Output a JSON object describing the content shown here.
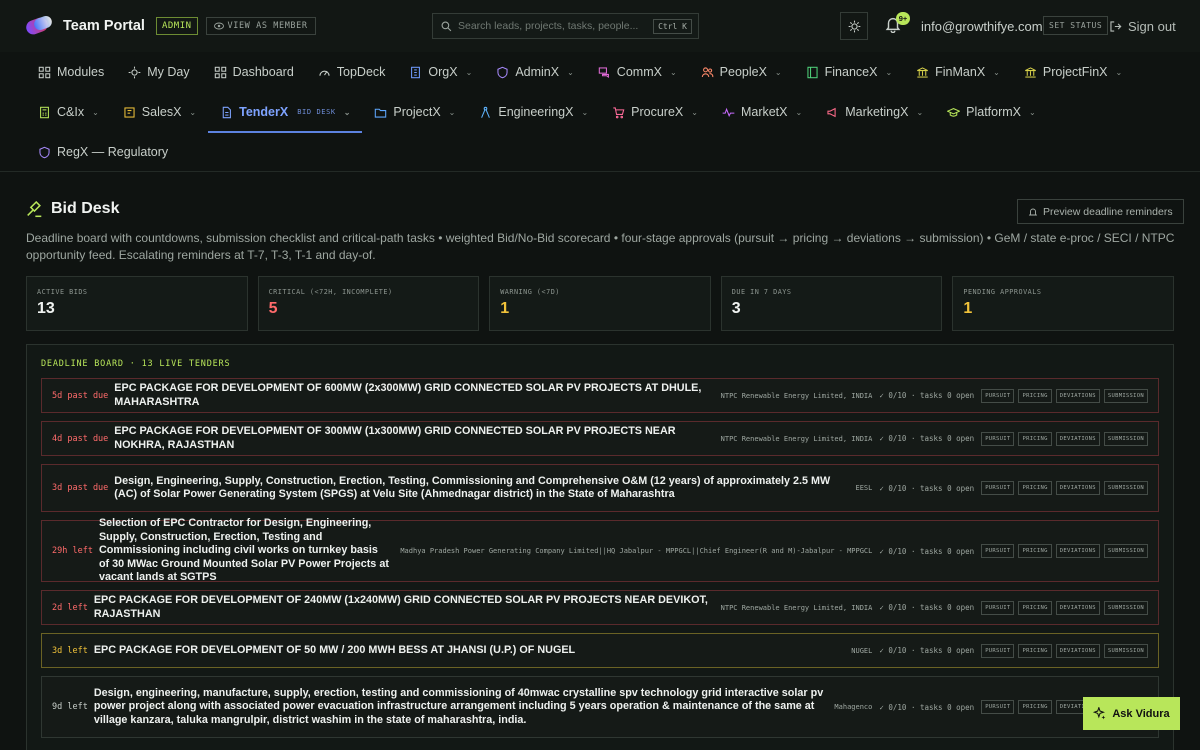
{
  "header": {
    "brand": "Team Portal",
    "admin_badge": "ADMIN",
    "view_as_member": "VIEW AS MEMBER",
    "search_placeholder": "Search leads, projects, tasks, people...",
    "search_shortcut": "Ctrl K",
    "notifications": "9+",
    "email": "info@growthifye.com",
    "set_status": "SET STATUS",
    "sign_out": "Sign out"
  },
  "nav": {
    "row1": [
      {
        "label": "Modules",
        "icon": "grid-icon",
        "chevron": false
      },
      {
        "label": "My Day",
        "icon": "sun-icon",
        "chevron": false
      },
      {
        "label": "Dashboard",
        "icon": "grid-icon",
        "chevron": false
      },
      {
        "label": "TopDeck",
        "icon": "gauge-icon",
        "chevron": false
      },
      {
        "label": "OrgX",
        "icon": "building-icon",
        "chevron": true
      },
      {
        "label": "AdminX",
        "icon": "shield-icon",
        "chevron": true
      },
      {
        "label": "CommX",
        "icon": "chat-icon",
        "chevron": true
      },
      {
        "label": "PeopleX",
        "icon": "people-icon",
        "chevron": true
      },
      {
        "label": "FinanceX",
        "icon": "ledger-icon",
        "chevron": true
      },
      {
        "label": "FinManX",
        "icon": "bank-icon",
        "chevron": true
      },
      {
        "label": "ProjectFinX",
        "icon": "bank-icon",
        "chevron": true
      }
    ],
    "row2": [
      {
        "label": "C&Ix",
        "icon": "calculator-icon",
        "chevron": true
      },
      {
        "label": "SalesX",
        "icon": "sales-icon",
        "chevron": true
      },
      {
        "label": "TenderX",
        "icon": "tender-icon",
        "chevron": true,
        "sub": "BID DESK",
        "active": true
      },
      {
        "label": "ProjectX",
        "icon": "folder-icon",
        "chevron": true
      },
      {
        "label": "EngineeringX",
        "icon": "compass-icon",
        "chevron": true
      },
      {
        "label": "ProcureX",
        "icon": "cart-icon",
        "chevron": true
      },
      {
        "label": "MarketX",
        "icon": "pulse-icon",
        "chevron": true
      },
      {
        "label": "MarketingX",
        "icon": "megaphone-icon",
        "chevron": true
      },
      {
        "label": "PlatformX",
        "icon": "cap-icon",
        "chevron": true
      }
    ],
    "row3": [
      {
        "label": "RegX — Regulatory",
        "icon": "shield-icon",
        "chevron": false
      }
    ]
  },
  "page": {
    "title": "Bid Desk",
    "preview_button": "Preview deadline reminders",
    "description": "Deadline board with countdowns, submission checklist and critical-path tasks • weighted Bid/No-Bid scorecard • four-stage approvals (pursuit → pricing → deviations → submission) • GeM / state e-proc / SECI / NTPC opportunity feed. Escalating reminders at T-7, T-3, T-1 and day-of."
  },
  "stats": [
    {
      "label": "ACTIVE BIDS",
      "value": "13",
      "color": "#f0f3f1"
    },
    {
      "label": "CRITICAL (<72H, INCOMPLETE)",
      "value": "5",
      "color": "#ff6b6b"
    },
    {
      "label": "WARNING (<7D)",
      "value": "1",
      "color": "#f0c23a"
    },
    {
      "label": "DUE IN 7 DAYS",
      "value": "3",
      "color": "#f0f3f1"
    },
    {
      "label": "PENDING APPROVALS",
      "value": "1",
      "color": "#f0c23a"
    }
  ],
  "board": {
    "title": "DEADLINE BOARD · 13 LIVE TENDERS",
    "stages": [
      "PURSUIT",
      "PRICING",
      "DEVIATIONS",
      "SUBMISSION"
    ],
    "tenders": [
      {
        "due": "5d past due",
        "level": "critical",
        "title": "EPC PACKAGE FOR DEVELOPMENT OF 600MW (2x300MW) GRID CONNECTED SOLAR PV PROJECTS AT DHULE, MAHARASHTRA",
        "org": "NTPC Renewable Energy Limited, INDIA",
        "tasks": "✓ 0/10 · tasks 0 open"
      },
      {
        "due": "4d past due",
        "level": "critical",
        "title": "EPC PACKAGE FOR DEVELOPMENT OF 300MW (1x300MW) GRID CONNECTED SOLAR PV PROJECTS NEAR NOKHRA, RAJASTHAN",
        "org": "NTPC Renewable Energy Limited, INDIA",
        "tasks": "✓ 0/10 · tasks 0 open"
      },
      {
        "due": "3d past due",
        "level": "critical",
        "title": "Design, Engineering, Supply, Construction, Erection, Testing, Commissioning and Comprehensive O&M (12 years) of approximately 2.5 MW (AC) of Solar Power Generating System (SPGS) at Velu Site (Ahmednagar district) in the State of Maharashtra",
        "org": "EESL",
        "tasks": "✓ 0/10 · tasks 0 open"
      },
      {
        "due": "29h left",
        "level": "critical",
        "title": "Selection of EPC Contractor for Design, Engineering, Supply, Construction, Erection, Testing and Commissioning including civil works on turnkey basis of 30 MWac Ground Mounted Solar PV Power Projects at vacant lands at SGTPS",
        "org": "Madhya Pradesh Power Generating Company Limited||HQ Jabalpur - MPPGCL||Chief Engineer(R and M)-Jabalpur - MPPGCL",
        "tasks": "✓ 0/10 · tasks 0 open"
      },
      {
        "due": "2d left",
        "level": "critical",
        "title": "EPC PACKAGE FOR DEVELOPMENT OF 240MW (1x240MW) GRID CONNECTED SOLAR PV PROJECTS NEAR DEVIKOT, RAJASTHAN",
        "org": "NTPC Renewable Energy Limited, INDIA",
        "tasks": "✓ 0/10 · tasks 0 open"
      },
      {
        "due": "3d left",
        "level": "warn",
        "title": "EPC PACKAGE FOR DEVELOPMENT OF 50 MW / 200 MWH BESS AT JHANSI (U.P.) OF NUGEL",
        "org": "NUGEL",
        "tasks": "✓ 0/10 · tasks 0 open"
      },
      {
        "due": "9d left",
        "level": "norm",
        "title": "Design, engineering, manufacture, supply, erection, testing and commissioning of 40mwac crystalline spv technology grid interactive solar pv power project along with associated power evacuation infrastructure arrangement including 5 years operation & maintenance of the same at village kanzara, taluka mangrulpir, district washim in the state of maharashtra, india.",
        "org": "Mahagenco",
        "tasks": "✓ 0/10 · tasks 0 open"
      }
    ]
  },
  "ask_button": "Ask Vidura",
  "colors": {
    "accent": "#b8e65a",
    "critical": "#ff6b6b",
    "warning": "#f0c23a",
    "active_nav": "#7ea3ff"
  }
}
